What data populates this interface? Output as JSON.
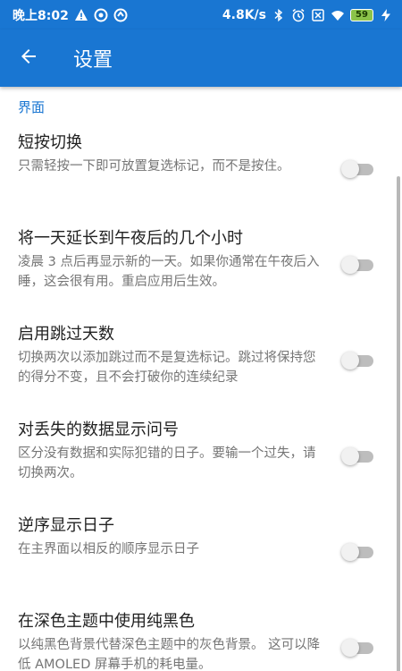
{
  "status_bar": {
    "time": "晚上8:02",
    "net_speed": "4.8K/s",
    "battery": "59",
    "icons": [
      "warning-icon",
      "app-icon",
      "app-icon",
      "bluetooth-icon",
      "alarm-icon",
      "sim-icon",
      "wifi-icon",
      "battery-icon",
      "charging-icon"
    ]
  },
  "appbar": {
    "title": "设置",
    "back_icon": "arrow-left-icon"
  },
  "section": {
    "header": "界面"
  },
  "settings": [
    {
      "title": "短按切换",
      "desc": "只需轻按一下即可放置复选标记，而不是按住。",
      "enabled": false
    },
    {
      "title": "将一天延长到午夜后的几个小时",
      "desc": "凌晨 3 点后再显示新的一天。如果你通常在午夜后入睡，这会很有用。重启应用后生效。",
      "enabled": false
    },
    {
      "title": "启用跳过天数",
      "desc": "切换两次以添加跳过而不是复选标记。跳过将保持您的得分不变，且不会打破你的连续纪录",
      "enabled": false
    },
    {
      "title": "对丢失的数据显示问号",
      "desc": "区分没有数据和实际犯错的日子。要输一个过失，请切换两次。",
      "enabled": false
    },
    {
      "title": "逆序显示日子",
      "desc": "在主界面以相反的顺序显示日子",
      "enabled": false
    },
    {
      "title": "在深色主题中使用纯黑色",
      "desc": "以纯黑色背景代替深色主题中的灰色背景。 这可以降低 AMOLED 屏幕手机的耗电量。",
      "enabled": false
    }
  ],
  "colors": {
    "primary": "#1976d2",
    "title_text": "#212121",
    "desc_text": "#757575"
  }
}
